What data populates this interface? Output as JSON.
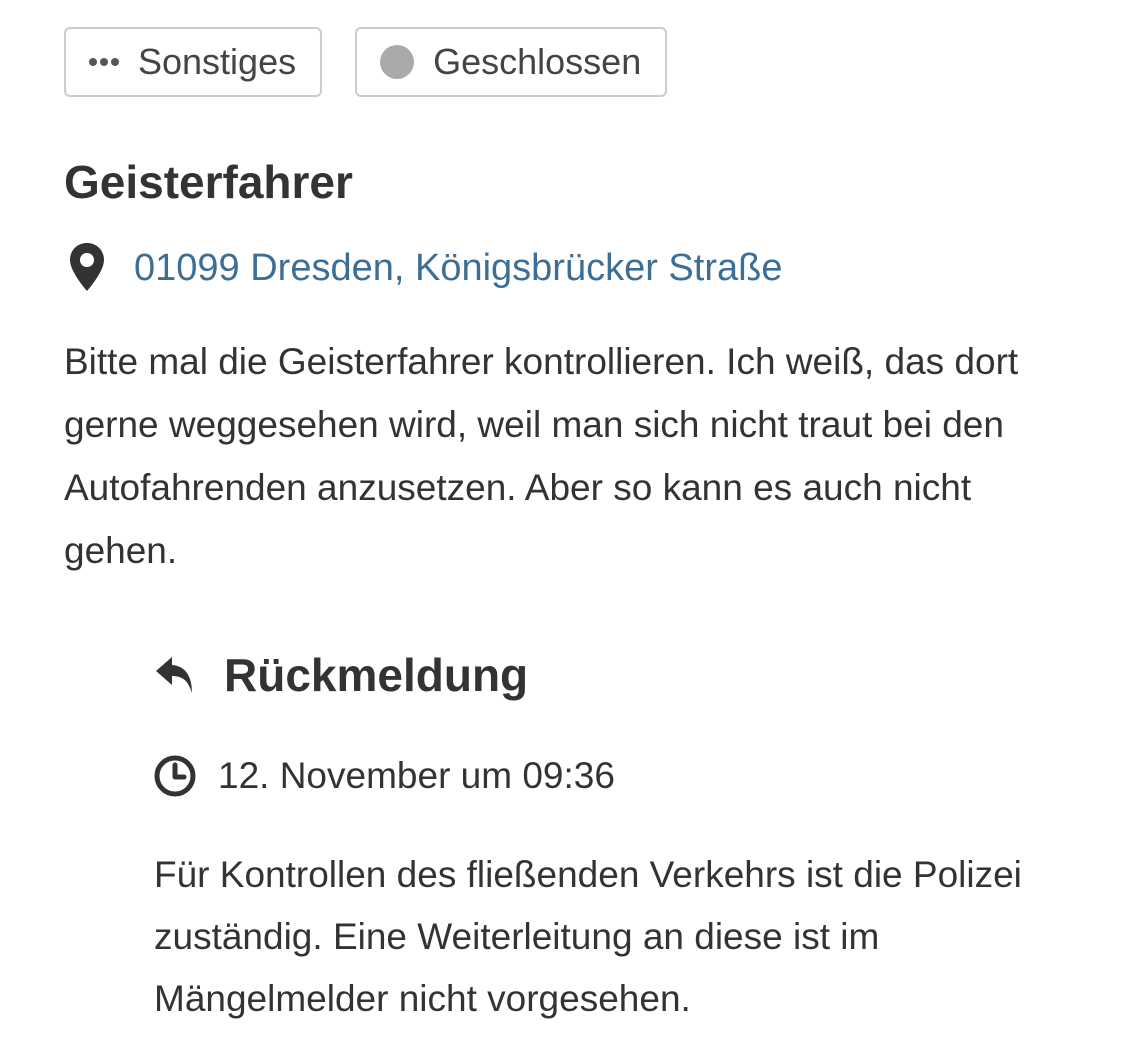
{
  "tags": {
    "category": {
      "label": "Sonstiges",
      "icon": "more-dots-icon"
    },
    "status": {
      "label": "Geschlossen",
      "icon": "status-dot-icon",
      "color": "#aaaaaa"
    }
  },
  "report": {
    "title": "Geisterfahrer",
    "address": "01099 Dresden, Königsbrücker Straße",
    "address_icon": "map-pin-icon",
    "description": "Bitte mal die Geisterfahrer kontrollieren. Ich weiß, das dort gerne weggesehen wird, weil man sich nicht traut bei den Autofahrenden anzusetzen. Aber so kann es auch nicht gehen."
  },
  "feedback": {
    "heading": "Rückmeldung",
    "heading_icon": "reply-icon",
    "date": "12. November um 09:36",
    "date_icon": "clock-icon",
    "text": "Für Kontrollen des fließenden Verkehrs ist die Polizei zuständig. Eine Weiterleitung an diese ist im Mängelmelder nicht vorgesehen."
  },
  "colors": {
    "link": "#3d6f96",
    "text": "#333333",
    "border": "#cccccc"
  }
}
